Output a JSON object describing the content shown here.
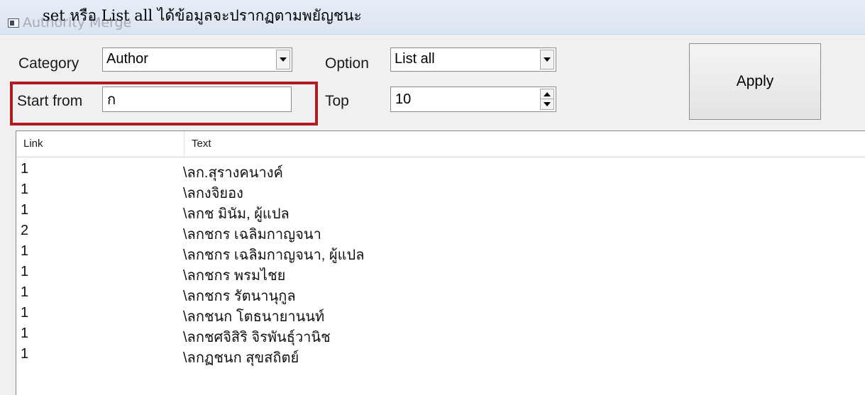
{
  "window": {
    "title": "Authority Merge",
    "caption_overlay": "set หรือ List all ได้ข้อมูลจะปรากฏตามพยัญชนะ"
  },
  "form": {
    "category_label": "Category",
    "category_value": "Author",
    "option_label": "Option",
    "option_value": "List all",
    "start_from_label": "Start from",
    "start_from_value": "ก",
    "top_label": "Top",
    "top_value": "10",
    "apply_label": "Apply"
  },
  "list": {
    "columns": [
      "Link",
      "Text"
    ],
    "rows": [
      {
        "link": "1",
        "text": "\\ลก.สุรางคนางค์"
      },
      {
        "link": "1",
        "text": "\\ลกงจิยอง"
      },
      {
        "link": "1",
        "text": "\\ลกช มินัม, ผู้แปล"
      },
      {
        "link": "2",
        "text": "\\ลกชกร เฉลิมกาญจนา"
      },
      {
        "link": "1",
        "text": "\\ลกชกร เฉลิมกาญจนา, ผู้แปล"
      },
      {
        "link": "1",
        "text": "\\ลกชกร พรมไชย"
      },
      {
        "link": "1",
        "text": "\\ลกชกร รัตนานุกูล"
      },
      {
        "link": "1",
        "text": "\\ลกชนก โตธนายานนท์"
      },
      {
        "link": "1",
        "text": "\\ลกชศจิสิริ จิรพันธุ์วานิช"
      },
      {
        "link": "1",
        "text": "\\ลกฏชนก สุขสถิตย์"
      }
    ]
  },
  "colors": {
    "highlight_border": "#b11c24",
    "titlebar": "#dbe5f1",
    "window_bg": "#f0f0f0"
  },
  "icons": {
    "app": "window-icon",
    "dropdown": "chevron-down-icon",
    "spin_up": "arrow-up-icon",
    "spin_down": "arrow-down-icon"
  }
}
